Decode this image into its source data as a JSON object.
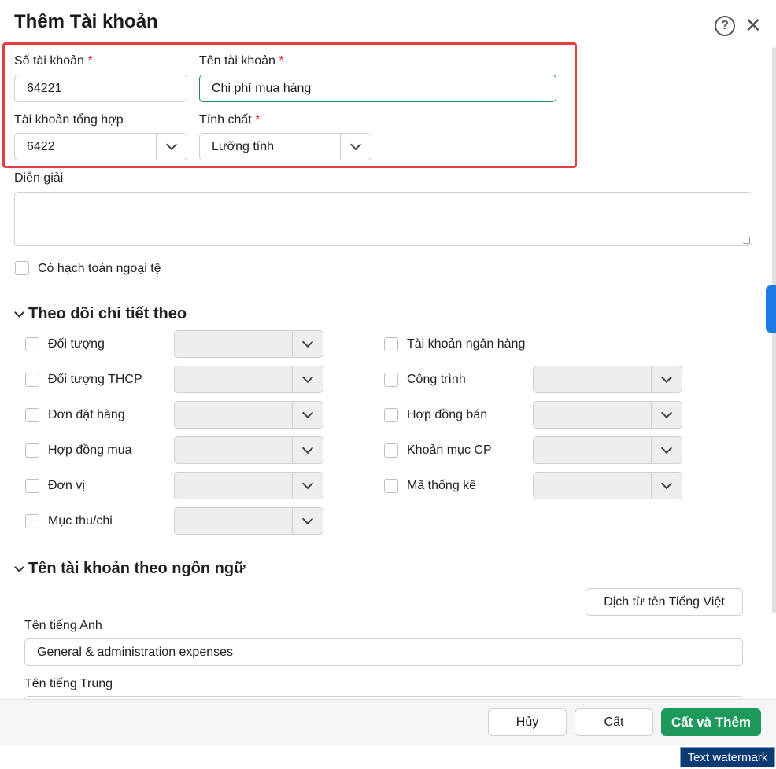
{
  "dialog": {
    "title": "Thêm Tài khoản"
  },
  "fields": {
    "account_number": {
      "label": "Số tài khoản",
      "required": "*",
      "value": "64221"
    },
    "account_name": {
      "label": "Tên tài khoản",
      "required": "*",
      "value": "Chi phí mua hàng"
    },
    "parent_account": {
      "label": "Tài khoản tổng hợp",
      "value": "6422"
    },
    "nature": {
      "label": "Tính chất",
      "required": "*",
      "value": "Lưỡng tính"
    },
    "description": {
      "label": "Diễn giải",
      "value": ""
    },
    "foreign_currency": {
      "label": "Có hạch toán ngoại tệ"
    }
  },
  "tracking": {
    "title": "Theo dõi chi tiết theo",
    "left": [
      "Đối tượng",
      "Đối tượng THCP",
      "Đơn đặt hàng",
      "Hợp đồng mua",
      "Đơn vị",
      "Mục thu/chi"
    ],
    "right": [
      "Tài khoản ngân hàng",
      "Công trình",
      "Hợp đồng bán",
      "Khoản mục CP",
      "Mã thống kê"
    ]
  },
  "languages": {
    "title": "Tên tài khoản theo ngôn ngữ",
    "translate_button": "Dịch từ tên Tiếng Việt",
    "english_label": "Tên tiếng Anh",
    "english_value": "General & administration expenses",
    "chinese_label": "Tên tiếng Trung"
  },
  "footer": {
    "cancel": "Hủy",
    "save": "Cất",
    "save_add": "Cất và Thêm"
  },
  "icons": {
    "help": "help-icon",
    "close": "close-icon",
    "dropdown": "chevron-down-icon"
  },
  "colors": {
    "primary": "#1d9a5b",
    "highlight": "#e04040",
    "required": "#e53935",
    "focus": "#1a8a6e"
  },
  "watermark": "Text watermark"
}
